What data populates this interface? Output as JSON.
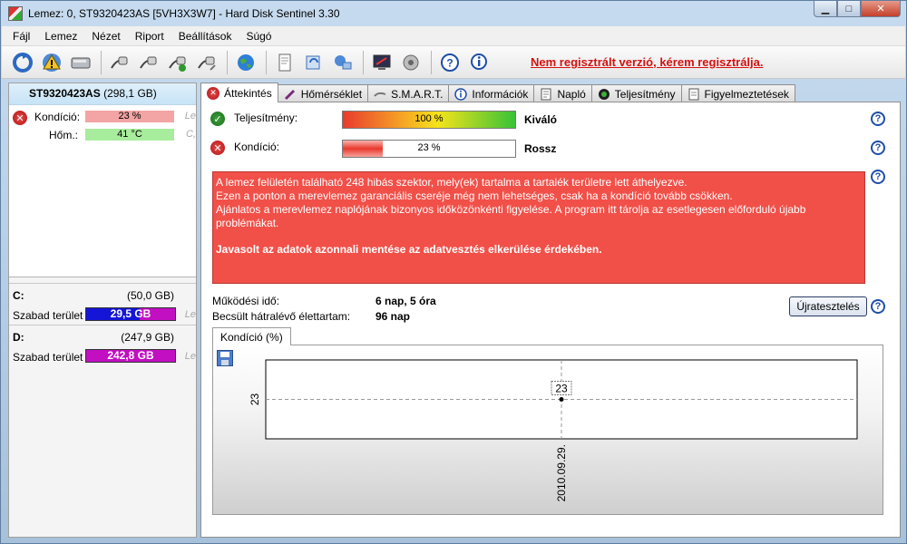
{
  "window": {
    "title": "Lemez: 0, ST9320423AS [5VH3X3W7]  -  Hard Disk Sentinel 3.30",
    "minimize": "▁",
    "maximize": "□",
    "close": "✕"
  },
  "menu": [
    "Fájl",
    "Lemez",
    "Nézet",
    "Riport",
    "Beállítások",
    "Súgó"
  ],
  "toolbar": {
    "icons": [
      "refresh-icon",
      "warning-icon",
      "disk-icon",
      "plug-icon",
      "plug-icon",
      "plug-check-icon",
      "plug-tool-icon",
      "globe-icon",
      "report-icon",
      "sync-icon",
      "network-icon",
      "monitor-icon",
      "speaker-icon",
      "help-icon",
      "info-icon"
    ],
    "register_text": "Nem regisztrált verzió, kérem regisztrálja."
  },
  "disk": {
    "name": "ST9320423AS",
    "size": "(298,1 GB)",
    "condition_label": "Kondíció:",
    "condition_value": "23 %",
    "condition_percent": 23,
    "temp_label": "Hőm.:",
    "temp_value": "41 °C",
    "cut_text_1": "Le",
    "cut_text_2": "C,"
  },
  "volumes": [
    {
      "letter": "C:",
      "size": "(50,0 GB)",
      "free_label": "Szabad terület",
      "free_value": "29,5 GB",
      "cut": "Le",
      "color": "#1010c8"
    },
    {
      "letter": "D:",
      "size": "(247,9 GB)",
      "free_label": "Szabad terület",
      "free_value": "242,8 GB",
      "cut": "Le",
      "color": "#c10fc1"
    }
  ],
  "tabs": [
    {
      "label": "Áttekintés",
      "icon": "error-icon",
      "active": true
    },
    {
      "label": "Hőmérséklet",
      "icon": "thermometer-icon"
    },
    {
      "label": "S.M.A.R.T.",
      "icon": "smart-icon"
    },
    {
      "label": "Információk",
      "icon": "info-icon"
    },
    {
      "label": "Napló",
      "icon": "log-icon"
    },
    {
      "label": "Teljesítmény",
      "icon": "gauge-icon"
    },
    {
      "label": "Figyelmeztetések",
      "icon": "document-icon"
    }
  ],
  "overview": {
    "performance_label": "Teljesítmény:",
    "performance_value": "100 %",
    "performance_percent": 100,
    "performance_verdict": "Kiváló",
    "condition_label": "Kondíció:",
    "condition_value": "23 %",
    "condition_percent": 23,
    "condition_verdict": "Rossz",
    "help": "?",
    "alert_lines": [
      "A lemez felületén található 248 hibás szektor, mely(ek) tartalma a tartalék területre lett áthelyezve.",
      "Ezen a ponton a merevlemez garanciális cseréje még nem lehetséges, csak ha a kondíció tovább csökken.",
      "Ajánlatos a merevlemez naplójának bizonyos időközönkénti figyelése. A program itt tárolja az esetlegesen előforduló újabb problémákat."
    ],
    "alert_strong": "Javasolt az adatok azonnali mentése az adatvesztés elkerülése érdekében.",
    "uptime_label": "Működési idő:",
    "uptime_value": "6 nap, 5 óra",
    "lifetime_label": "Becsült hátralévő élettartam:",
    "lifetime_value": "96 nap",
    "retest_button": "Újratesztelés"
  },
  "chart_tab_label": "Kondíció  (%)",
  "chart_data": {
    "type": "line",
    "x": [
      "2010.09.29."
    ],
    "series": [
      {
        "values": [
          23
        ]
      }
    ],
    "yticks": [
      "23"
    ],
    "data_labels": [
      "23"
    ]
  }
}
